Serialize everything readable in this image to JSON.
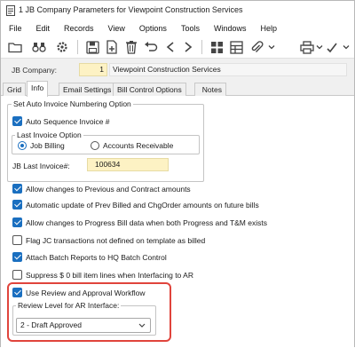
{
  "window": {
    "title": "1 JB Company Parameters for Viewpoint Construction Services"
  },
  "menu": [
    "File",
    "Edit",
    "Records",
    "View",
    "Options",
    "Tools",
    "Windows",
    "Help"
  ],
  "company": {
    "label": "JB Company:",
    "number": "1",
    "name": "Viewpoint Construction Services"
  },
  "tabs": [
    "Grid",
    "Info",
    "Email Settings",
    "Bill Control Options",
    "Notes"
  ],
  "active_tab": "Info",
  "invoice_group": {
    "title": "Set Auto Invoice Numbering Option",
    "auto_sequence_label": "Auto Sequence Invoice #",
    "auto_sequence_checked": true,
    "last_invoice_option_title": "Last Invoice Option",
    "radio_job_billing": "Job Billing",
    "radio_accounts_receivable": "Accounts Receivable",
    "selected_option": "Job Billing",
    "last_invoice_label": "JB Last Invoice#:",
    "last_invoice_value": "100634"
  },
  "options": [
    {
      "label": "Allow changes to Previous and Contract amounts",
      "checked": true
    },
    {
      "label": "Automatic update of Prev Billed and ChgOrder amounts on future bills",
      "checked": true
    },
    {
      "label": "Allow changes to Progress Bill data when both Progress and T&M exists",
      "checked": true
    },
    {
      "label": "Flag JC transactions not defined on template as billed",
      "checked": false
    },
    {
      "label": "Attach Batch Reports to HQ Batch Control",
      "checked": true
    },
    {
      "label": "Suppress $ 0 bill item lines when Interfacing to AR",
      "checked": false
    }
  ],
  "review": {
    "label": "Use Review and Approval Workflow",
    "checked": true,
    "level_title": "Review Level for AR Interface:",
    "level_value": "2 - Draft Approved"
  },
  "colors": {
    "accent": "#1a6fc0",
    "highlight": "#e0443c",
    "input_yellow": "#fdf2c4"
  }
}
